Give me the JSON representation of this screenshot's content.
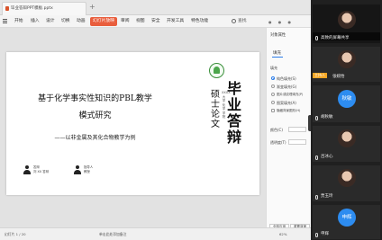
{
  "window": {
    "tab_title": "毕业答辩PPT模板.pptx"
  },
  "menu": {
    "items": [
      "开始",
      "插入",
      "设计",
      "切换",
      "动画",
      "幻灯片放映",
      "审阅",
      "视图",
      "安全",
      "开发工具",
      "特色功能"
    ],
    "active": "幻灯片放映",
    "search": "查找"
  },
  "slide": {
    "title_line1": "基于化学事实性知识的PBL教学",
    "title_line2": "模式研究",
    "subtitle": "——以非金属及其化合物教学为例",
    "presenter_label_1": "答辩",
    "presenter_name_1": "刘 XX 答辩",
    "presenter_label_2": "指导人",
    "presenter_name_2": "教授",
    "big_title": "毕业答辩",
    "mid_title": "硕士论文",
    "vertical_small": "XXXX大学化学学院"
  },
  "side_panel": {
    "header": "对象属性",
    "tab": "填充",
    "section": "填充",
    "options": [
      "纯色填充(S)",
      "渐变填充(G)",
      "图片或纹理填充(P)",
      "图案填充(A)",
      "隐藏背景图形(H)"
    ],
    "color_label": "颜色(C)",
    "transparency_label": "透明度(T)",
    "apply_all": "全部应用",
    "reset": "重置背景"
  },
  "status_bar": {
    "left": "幻灯片 1 / 20",
    "notes": "单击此处添加备注",
    "zoom": "62%"
  },
  "meeting": {
    "screen_share_label": "高致的屏幕共享",
    "host_badge": "主持人",
    "participants": [
      {
        "name": "张婉怡",
        "avatar_text": ""
      },
      {
        "name": "胡秋敏",
        "avatar_text": "秋敏"
      },
      {
        "name": "吕冰心",
        "avatar_text": ""
      },
      {
        "name": "贾玉玲",
        "avatar_text": ""
      },
      {
        "name": "申辉",
        "avatar_text": "申辉"
      }
    ]
  }
}
